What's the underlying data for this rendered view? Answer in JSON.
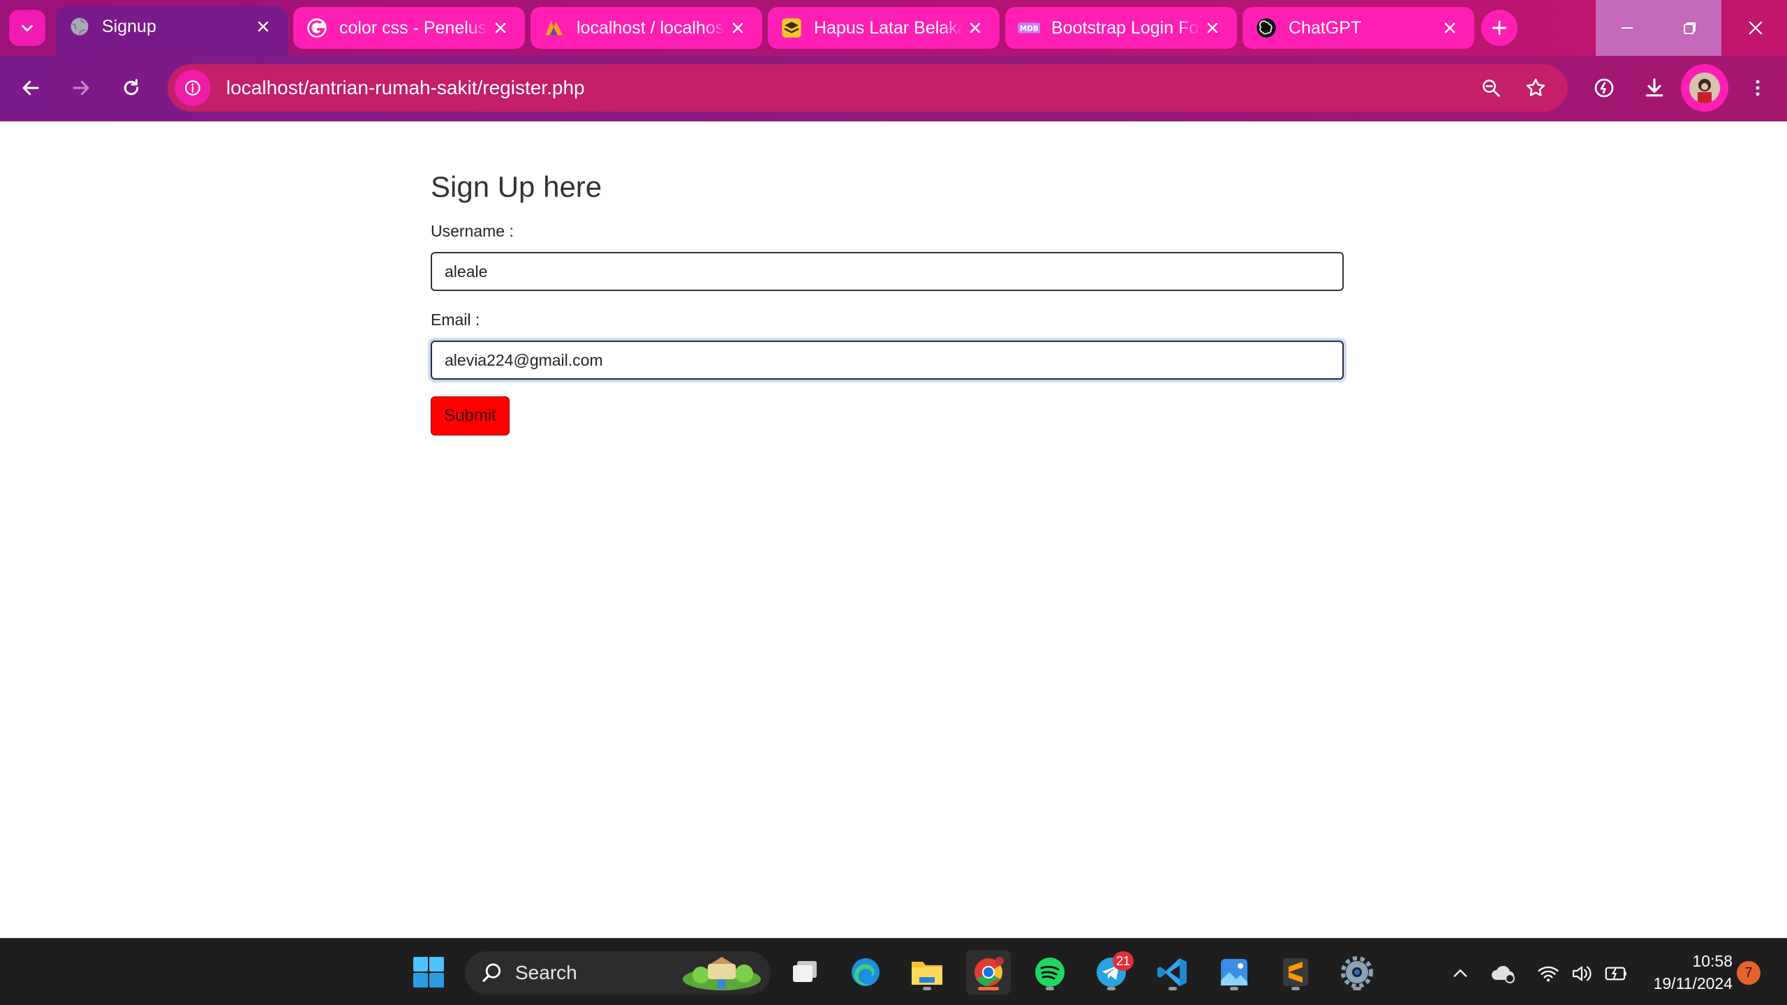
{
  "browser": {
    "tabs": [
      {
        "title": "Signup",
        "favicon": "globe-icon",
        "active": true
      },
      {
        "title": "color css - Penelusuran Google",
        "favicon": "google-icon",
        "active": false
      },
      {
        "title": "localhost / localhost / phpMyAdmin",
        "favicon": "phpmyadmin-icon",
        "active": false
      },
      {
        "title": "Hapus Latar Belakang",
        "favicon": "layers-icon",
        "active": false
      },
      {
        "title": "Bootstrap Login Form",
        "favicon": "mdb-icon",
        "active": false
      },
      {
        "title": "ChatGPT",
        "favicon": "openai-icon",
        "active": false
      }
    ],
    "url": "localhost/antrian-rumah-sakit/register.php",
    "colors": {
      "tab_strip": "#9b1278",
      "tab": "#ff1fb4",
      "active_tab": "#7a1a8a",
      "omnibox": "#c41f68"
    }
  },
  "page": {
    "title": "Sign Up here",
    "username_label": "Username :",
    "username_value": "aleale",
    "email_label": "Email :",
    "email_value": "alevia224@gmail.com",
    "submit_label": "Submit",
    "submit_color": "#ff0000"
  },
  "taskbar": {
    "search_label": "Search",
    "apps": [
      {
        "name": "start-icon"
      },
      {
        "name": "task-view-icon"
      },
      {
        "name": "edge-icon"
      },
      {
        "name": "file-explorer-icon"
      },
      {
        "name": "chrome-icon"
      },
      {
        "name": "spotify-icon"
      },
      {
        "name": "telegram-icon",
        "badge": "21"
      },
      {
        "name": "vscode-icon"
      },
      {
        "name": "photos-icon"
      },
      {
        "name": "sublime-text-icon"
      },
      {
        "name": "settings-icon"
      }
    ],
    "time": "10:58",
    "date": "19/11/2024",
    "notification_count": "7"
  }
}
